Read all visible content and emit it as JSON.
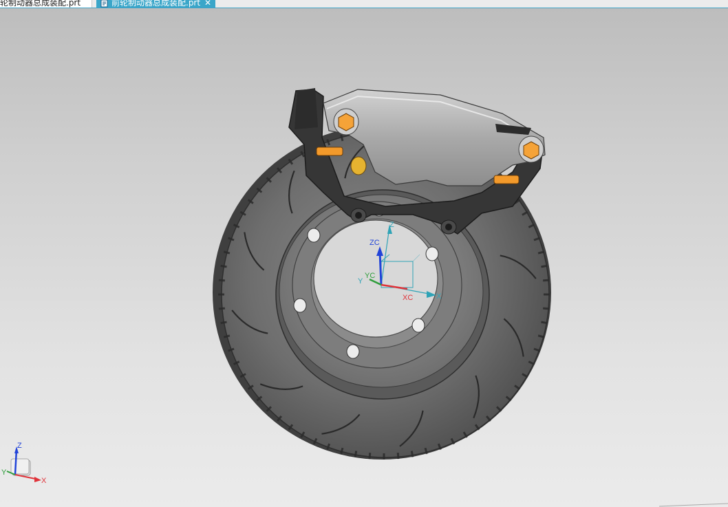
{
  "tabs": [
    {
      "label": "轮制动器总成装配.prt",
      "active": false
    },
    {
      "label": "前轮制动器总成装配.prt",
      "active": true,
      "close_glyph": "✕"
    }
  ],
  "icons": {
    "document": "nx-part-file-icon",
    "close": "close-icon"
  },
  "wcs": {
    "xc": "XC",
    "yc": "YC",
    "zc": "ZC",
    "x": "X",
    "y": "Y",
    "z": "Z"
  },
  "view_triad": {
    "x": "X",
    "y": "Y",
    "z": "Z"
  },
  "colors": {
    "tab_active": "#3aa6c9",
    "axis_x": "#e0333a",
    "axis_y": "#2e9d3a",
    "axis_z": "#2244d8",
    "datum": "#2fa3b6",
    "bolt": "#f39a2b",
    "caliper": "#a7a7a7",
    "rotor": "#6d6d6d"
  }
}
